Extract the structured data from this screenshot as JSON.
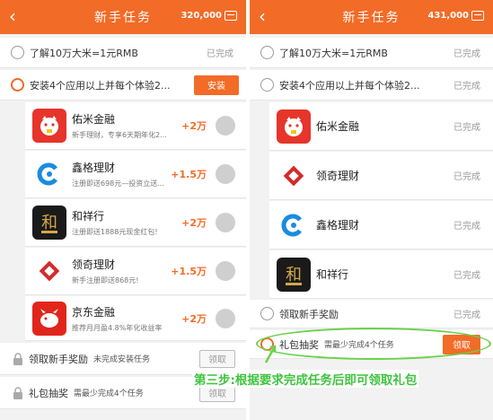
{
  "left": {
    "title": "新手任务",
    "coins": "320,000",
    "tasks": {
      "understand": {
        "label": "了解10万大米=1元RMB",
        "status": "已完成"
      },
      "install": {
        "label": "安装4个应用以上并每个体验2...",
        "button": "安装"
      }
    },
    "apps": [
      {
        "name": "佑米金融",
        "desc": "新手理财，专享6天期年化2...",
        "reward": "+2万"
      },
      {
        "name": "鑫格理财",
        "desc": "注册即送698元—投资立送...",
        "reward": "+1.5万"
      },
      {
        "name": "和祥行",
        "desc": "注册即送1888元现金红包!",
        "reward": "+2万"
      },
      {
        "name": "领奇理财",
        "desc": "新手注册即送868元!",
        "reward": "+1.5万"
      },
      {
        "name": "京东金融",
        "desc": "推荐月月盈4.8%年化收益率",
        "reward": "+2万"
      }
    ],
    "locked": [
      {
        "label": "领取新手奖励",
        "hint": "未完成安装任务",
        "button": "领取"
      },
      {
        "label": "礼包抽奖",
        "hint": "需最少完成4个任务",
        "button": "领取"
      }
    ]
  },
  "right": {
    "title": "新手任务",
    "coins": "431,000",
    "tasks": {
      "understand": {
        "label": "了解10万大米=1元RMB",
        "status": "已完成"
      },
      "install": {
        "label": "安装4个应用以上并每个体验2...",
        "status": "已完成"
      }
    },
    "apps": [
      {
        "name": "佑米金融",
        "status": "已完成"
      },
      {
        "name": "领奇理财",
        "status": "已完成"
      },
      {
        "name": "鑫格理财",
        "status": "已完成"
      },
      {
        "name": "和祥行",
        "status": "已完成"
      }
    ],
    "reward_task": {
      "label": "领取新手奖励",
      "status": "已完成"
    },
    "lottery": {
      "label": "礼包抽奖",
      "hint": "需最少完成4个任务",
      "button": "领取"
    }
  },
  "caption": "第三步:根据要求完成任务后即可领取礼包",
  "icons": {
    "youmi": "lucky-cat-icon",
    "xinge": "blue-c-logo-icon",
    "hexiang": "he-character-logo-icon",
    "lingqi": "red-diamond-logo-icon",
    "jd": "jd-dog-logo-icon"
  },
  "colors": {
    "accent": "#f26b27",
    "highlight": "#6ad14b",
    "caption": "#3ec43e"
  }
}
